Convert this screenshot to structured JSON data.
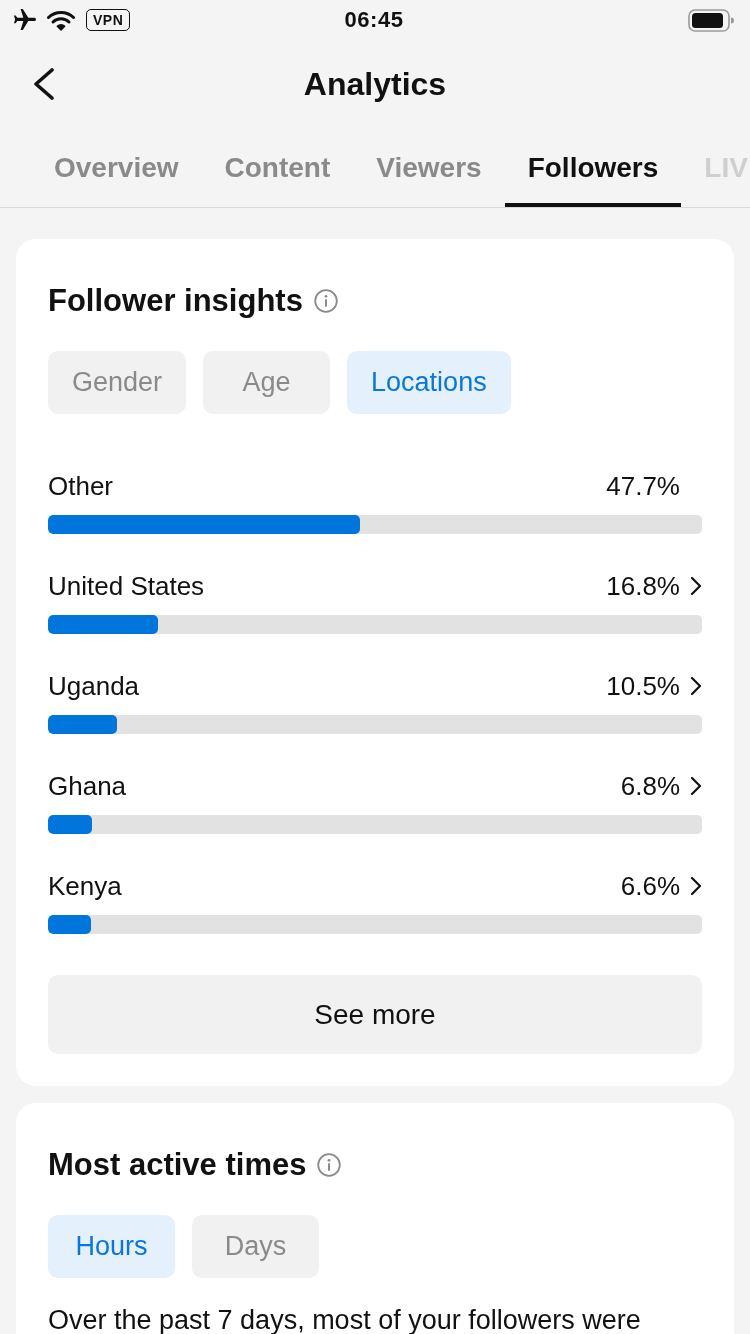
{
  "status_bar": {
    "vpn": "VPN",
    "time": "06:45"
  },
  "nav": {
    "title": "Analytics"
  },
  "tabs": [
    {
      "label": "Overview",
      "selected": false
    },
    {
      "label": "Content",
      "selected": false
    },
    {
      "label": "Viewers",
      "selected": false
    },
    {
      "label": "Followers",
      "selected": true
    },
    {
      "label": "LIV",
      "selected": false
    }
  ],
  "follower_insights": {
    "title": "Follower insights",
    "filters": [
      {
        "label": "Gender",
        "selected": false
      },
      {
        "label": "Age",
        "selected": false
      },
      {
        "label": "Locations",
        "selected": true
      }
    ],
    "locations": [
      {
        "name": "Other",
        "share": "47.7%",
        "level": 0.477,
        "has_details": false
      },
      {
        "name": "United States",
        "share": "16.8%",
        "level": 0.168,
        "has_details": true
      },
      {
        "name": "Uganda",
        "share": "10.5%",
        "level": 0.105,
        "has_details": true
      },
      {
        "name": "Ghana",
        "share": "6.8%",
        "level": 0.068,
        "has_details": true
      },
      {
        "name": "Kenya",
        "share": "6.6%",
        "level": 0.066,
        "has_details": true
      }
    ],
    "see_more": "See more"
  },
  "most_active_times": {
    "title": "Most active times",
    "filters": [
      {
        "label": "Hours",
        "selected": true
      },
      {
        "label": "Days",
        "selected": false
      }
    ],
    "summary": "Over the past 7 days, most of your followers were"
  }
}
